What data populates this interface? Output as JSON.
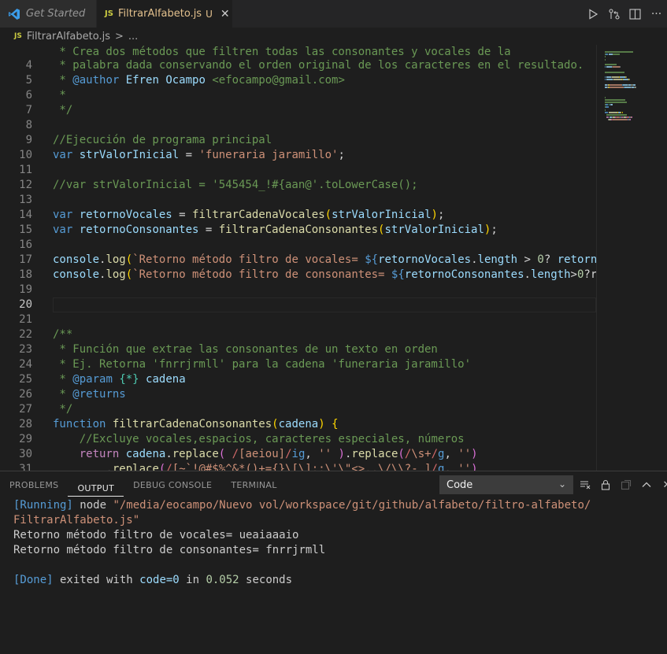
{
  "tabs": [
    {
      "label": "Get Started",
      "state": "inactive"
    },
    {
      "label": "FiltrarAlfabeto.js",
      "badge": "U",
      "state": "active",
      "file_type": "JS"
    }
  ],
  "tab_actions": [
    "run-icon",
    "source-control-compare-icon",
    "split-editor-icon",
    "more-actions-icon"
  ],
  "breadcrumb": {
    "file_type": "JS",
    "file": "FiltrarAlfabeto.js",
    "separator": ">",
    "symbol": "..."
  },
  "editor": {
    "current_line": 20,
    "lines": [
      {
        "n": 4,
        "tokens": [
          [
            " * palabra dada conservando el orden original de los caracteres en el resultado.",
            "com"
          ]
        ]
      },
      {
        "n": 5,
        "tokens": [
          [
            " * ",
            "com"
          ],
          [
            "@author",
            "kw"
          ],
          [
            " ",
            "com"
          ],
          [
            "Efren Ocampo",
            "var"
          ],
          [
            " <efocampo@gmail.com>",
            "com"
          ]
        ]
      },
      {
        "n": 6,
        "tokens": [
          [
            " *",
            "com"
          ]
        ]
      },
      {
        "n": 7,
        "tokens": [
          [
            " */",
            "com"
          ]
        ]
      },
      {
        "n": 8,
        "tokens": []
      },
      {
        "n": 9,
        "tokens": [
          [
            "//Ejecución de programa principal",
            "com"
          ]
        ]
      },
      {
        "n": 10,
        "tokens": [
          [
            "var",
            "kw"
          ],
          [
            " ",
            "punc"
          ],
          [
            "strValorInicial",
            "var"
          ],
          [
            " = ",
            "punc"
          ],
          [
            "'funeraria jaramillo'",
            "str"
          ],
          [
            ";",
            "punc"
          ]
        ]
      },
      {
        "n": 11,
        "tokens": []
      },
      {
        "n": 12,
        "tokens": [
          [
            "//var strValorInicial = '545454_!#{aan@'.toLowerCase();",
            "com"
          ]
        ]
      },
      {
        "n": 13,
        "tokens": []
      },
      {
        "n": 14,
        "tokens": [
          [
            "var",
            "kw"
          ],
          [
            " ",
            "punc"
          ],
          [
            "retornoVocales",
            "var"
          ],
          [
            " = ",
            "punc"
          ],
          [
            "filtrarCadenaVocales",
            "fn"
          ],
          [
            "(",
            "br1"
          ],
          [
            "strValorInicial",
            "var"
          ],
          [
            ")",
            "br1"
          ],
          [
            ";",
            "punc"
          ]
        ]
      },
      {
        "n": 15,
        "tokens": [
          [
            "var",
            "kw"
          ],
          [
            " ",
            "punc"
          ],
          [
            "retornoConsonantes",
            "var"
          ],
          [
            " = ",
            "punc"
          ],
          [
            "filtrarCadenaConsonantes",
            "fn"
          ],
          [
            "(",
            "br1"
          ],
          [
            "strValorInicial",
            "var"
          ],
          [
            ")",
            "br1"
          ],
          [
            ";",
            "punc"
          ]
        ]
      },
      {
        "n": 16,
        "tokens": []
      },
      {
        "n": 17,
        "tokens": [
          [
            "console",
            "var"
          ],
          [
            ".",
            "punc"
          ],
          [
            "log",
            "fn"
          ],
          [
            "(",
            "br1"
          ],
          [
            "`Retorno método filtro de vocales= ",
            "str"
          ],
          [
            "${",
            "kw"
          ],
          [
            "retornoVocales",
            "var"
          ],
          [
            ".",
            "punc"
          ],
          [
            "length",
            "var"
          ],
          [
            " > ",
            "punc"
          ],
          [
            "0",
            "num"
          ],
          [
            "? ",
            "punc"
          ],
          [
            "retorn",
            "var"
          ]
        ]
      },
      {
        "n": 18,
        "tokens": [
          [
            "console",
            "var"
          ],
          [
            ".",
            "punc"
          ],
          [
            "log",
            "fn"
          ],
          [
            "(",
            "br1"
          ],
          [
            "`Retorno método filtro de consonantes= ",
            "str"
          ],
          [
            "${",
            "kw"
          ],
          [
            "retornoConsonantes",
            "var"
          ],
          [
            ".",
            "punc"
          ],
          [
            "length",
            "var"
          ],
          [
            ">",
            "punc"
          ],
          [
            "0",
            "num"
          ],
          [
            "?r",
            "punc"
          ]
        ]
      },
      {
        "n": 19,
        "tokens": []
      },
      {
        "n": 20,
        "tokens": []
      },
      {
        "n": 21,
        "tokens": []
      },
      {
        "n": 22,
        "tokens": [
          [
            "/**",
            "com"
          ]
        ]
      },
      {
        "n": 23,
        "tokens": [
          [
            " * Función que extrae las consonantes de un texto en orden",
            "com"
          ]
        ]
      },
      {
        "n": 24,
        "tokens": [
          [
            " * Ej. Retorna 'fnrrjrmll' para la cadena 'funeraria jaramillo'",
            "com"
          ]
        ]
      },
      {
        "n": 25,
        "tokens": [
          [
            " * ",
            "com"
          ],
          [
            "@param",
            "kw"
          ],
          [
            " ",
            "com"
          ],
          [
            "{*}",
            "obj"
          ],
          [
            " ",
            "com"
          ],
          [
            "cadena",
            "var"
          ]
        ]
      },
      {
        "n": 26,
        "tokens": [
          [
            " * ",
            "com"
          ],
          [
            "@returns",
            "kw"
          ]
        ]
      },
      {
        "n": 27,
        "tokens": [
          [
            " */",
            "com"
          ]
        ]
      },
      {
        "n": 28,
        "tokens": [
          [
            "function",
            "kw"
          ],
          [
            " ",
            "punc"
          ],
          [
            "filtrarCadenaConsonantes",
            "fn"
          ],
          [
            "(",
            "br1"
          ],
          [
            "cadena",
            "var"
          ],
          [
            ")",
            "br1"
          ],
          [
            " ",
            "punc"
          ],
          [
            "{",
            "br1"
          ]
        ]
      },
      {
        "n": 29,
        "tokens": [
          [
            "    ",
            "punc"
          ],
          [
            "//Excluye vocales,espacios, caracteres especiales, números",
            "com"
          ]
        ]
      },
      {
        "n": 30,
        "tokens": [
          [
            "    ",
            "punc"
          ],
          [
            "return",
            "ctl"
          ],
          [
            " ",
            "punc"
          ],
          [
            "cadena",
            "var"
          ],
          [
            ".",
            "punc"
          ],
          [
            "replace",
            "fn"
          ],
          [
            "(",
            "br2"
          ],
          [
            " /",
            "re"
          ],
          [
            "[aeiou]",
            "str"
          ],
          [
            "/",
            "re"
          ],
          [
            "ig",
            "kw"
          ],
          [
            ", ",
            "punc"
          ],
          [
            "''",
            "str"
          ],
          [
            " )",
            "br2"
          ],
          [
            ".",
            "punc"
          ],
          [
            "replace",
            "fn"
          ],
          [
            "(",
            "br2"
          ],
          [
            "/",
            "re"
          ],
          [
            "\\s+",
            "str"
          ],
          [
            "/",
            "re"
          ],
          [
            "g",
            "kw"
          ],
          [
            ", ",
            "punc"
          ],
          [
            "''",
            "str"
          ],
          [
            ")",
            "br2"
          ]
        ]
      },
      {
        "n": 31,
        "tokens": [
          [
            "        ",
            "punc"
          ],
          [
            ".",
            "punc"
          ],
          [
            "replace",
            "fn"
          ],
          [
            "(",
            "br2"
          ],
          [
            "/",
            "re"
          ],
          [
            "[~`!@#$%^&*()+={}\\[\\];:\\'\\\"<>.,\\/\\\\?-_]",
            "str"
          ],
          [
            "/",
            "re"
          ],
          [
            "g",
            "kw"
          ],
          [
            ", ",
            "punc"
          ],
          [
            "''",
            "str"
          ],
          [
            ")",
            "br2"
          ]
        ]
      }
    ],
    "partial_top_line": " * Crea dos métodos que filtren todas las consonantes y vocales de la"
  },
  "panel": {
    "tabs": [
      "PROBLEMS",
      "OUTPUT",
      "DEBUG CONSOLE",
      "TERMINAL"
    ],
    "active_tab": "OUTPUT",
    "channel_select": "Code",
    "actions": [
      "clear-output-icon",
      "lock-scroll-icon",
      "open-log-icon",
      "maximize-panel-icon",
      "close-panel-icon"
    ],
    "output": {
      "running_label": "[Running]",
      "running_cmd": " node ",
      "running_path_1": "\"/media/eocampo/Nuevo vol/workspace/git/github/alfabeto/filtro-alfabeto/",
      "running_path_2": "FiltrarAlfabeto.js\"",
      "line_vocales": "Retorno método filtro de vocales= ueaiaaaio",
      "line_consonantes": "Retorno método filtro de consonantes= fnrrjrmll",
      "done_label": "[Done]",
      "done_text_1": " exited with ",
      "done_code": "code=0",
      "done_text_2": " in ",
      "done_time": "0.052",
      "done_text_3": " seconds"
    }
  },
  "colors": {
    "background": "#1e1e1e",
    "tabbar": "#252526",
    "comment": "#6a9955",
    "keyword": "#569cd6",
    "string": "#ce9178",
    "function": "#dcdcaa",
    "variable": "#9cdcfe",
    "modified": "#e2c08d"
  }
}
